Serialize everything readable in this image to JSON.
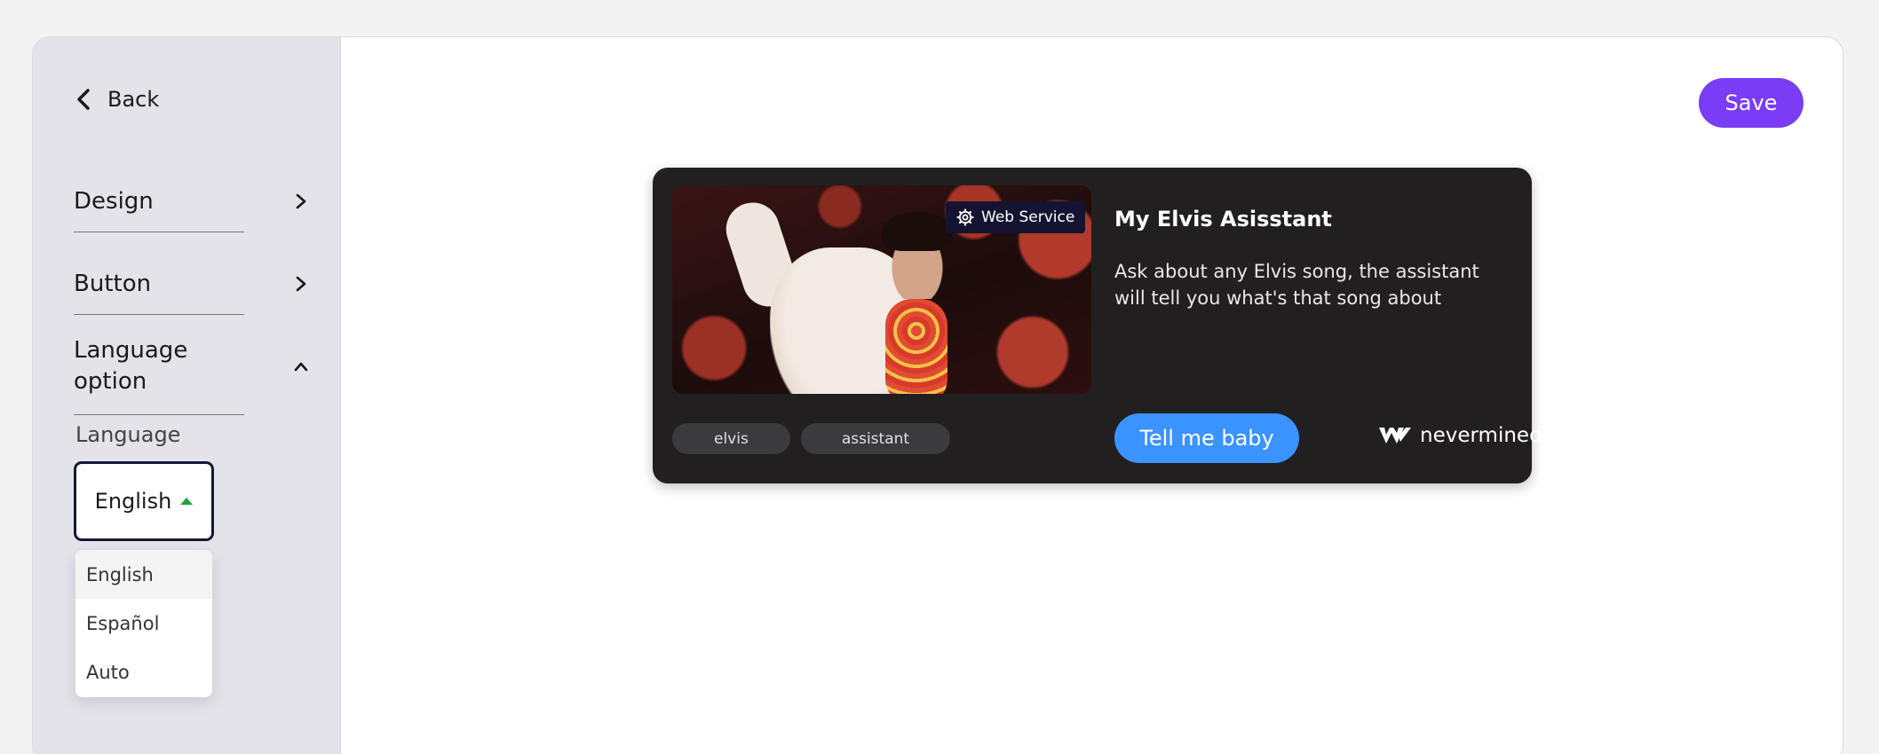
{
  "sidebar": {
    "back_label": "Back",
    "items": [
      {
        "label": "Design",
        "state": "collapsed"
      },
      {
        "label": "Button",
        "state": "collapsed"
      },
      {
        "label": "Language option",
        "state": "expanded"
      }
    ],
    "language": {
      "label": "Language",
      "selected": "English",
      "options": [
        "English",
        "Español",
        "Auto"
      ]
    }
  },
  "toolbar": {
    "save_label": "Save"
  },
  "card": {
    "badge_label": "Web Service",
    "title": "My Elvis Asisstant",
    "description": "Ask about any Elvis song, the assistant will tell you what's that song about",
    "tags": [
      "elvis",
      "assistant"
    ],
    "cta_label": "Tell me baby",
    "brand_name": "nevermined"
  },
  "colors": {
    "accent": "#7a3cf5",
    "cta": "#3b93ff",
    "card_bg": "#221f20",
    "sidebar_bg": "#e4e3ea"
  }
}
